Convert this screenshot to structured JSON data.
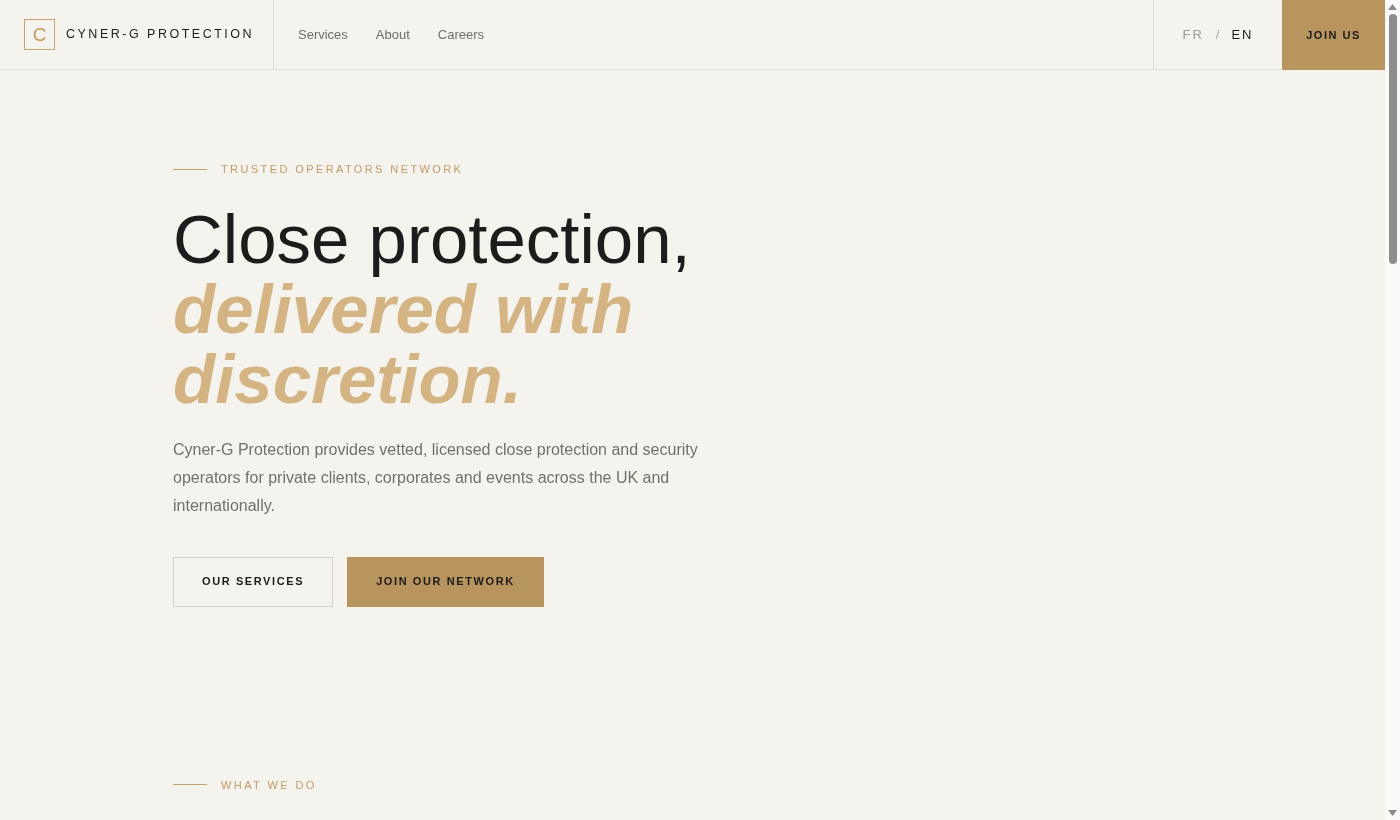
{
  "header": {
    "logo_letter": "C",
    "brand_name": "CYNER-G PROTECTION",
    "nav": [
      {
        "label": "Services"
      },
      {
        "label": "About"
      },
      {
        "label": "Careers"
      }
    ],
    "languages": [
      {
        "label": "FR",
        "selected": false
      },
      {
        "label": "EN",
        "selected": true
      }
    ],
    "language_separator": "/",
    "join_button": "JOIN US"
  },
  "hero": {
    "eyebrow": "TRUSTED OPERATORS NETWORK",
    "title": "Close protection, *delivered with discretion.*",
    "description": "Cyner-G Protection provides vetted, licensed close protection and security operators for private clients, corporates and events across the UK and internationally.",
    "buttons": [
      {
        "label": "OUR SERVICES",
        "kind": "outline"
      },
      {
        "label": "JOIN OUR NETWORK",
        "kind": "filled"
      }
    ]
  },
  "next_section": {
    "eyebrow": "WHAT WE DO"
  }
}
